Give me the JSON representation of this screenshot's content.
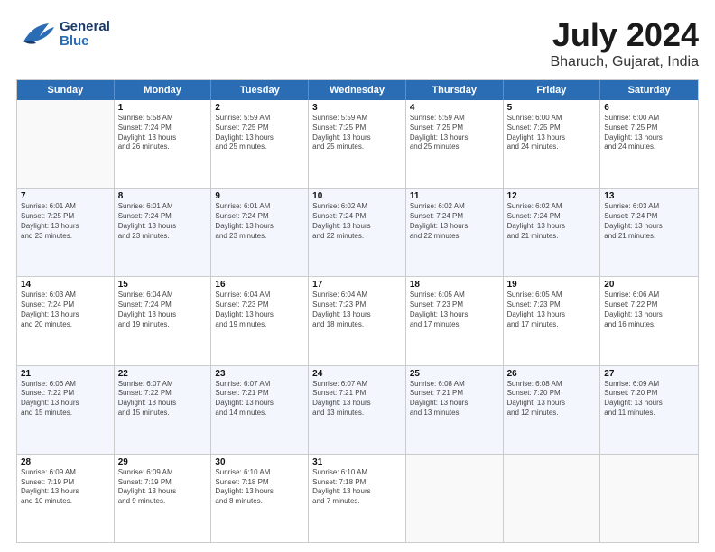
{
  "header": {
    "logo": {
      "general": "General",
      "blue": "Blue"
    },
    "title": "July 2024",
    "subtitle": "Bharuch, Gujarat, India"
  },
  "weekdays": [
    "Sunday",
    "Monday",
    "Tuesday",
    "Wednesday",
    "Thursday",
    "Friday",
    "Saturday"
  ],
  "weeks": [
    [
      {
        "day": "",
        "info": ""
      },
      {
        "day": "1",
        "info": "Sunrise: 5:58 AM\nSunset: 7:24 PM\nDaylight: 13 hours\nand 26 minutes."
      },
      {
        "day": "2",
        "info": "Sunrise: 5:59 AM\nSunset: 7:25 PM\nDaylight: 13 hours\nand 25 minutes."
      },
      {
        "day": "3",
        "info": "Sunrise: 5:59 AM\nSunset: 7:25 PM\nDaylight: 13 hours\nand 25 minutes."
      },
      {
        "day": "4",
        "info": "Sunrise: 5:59 AM\nSunset: 7:25 PM\nDaylight: 13 hours\nand 25 minutes."
      },
      {
        "day": "5",
        "info": "Sunrise: 6:00 AM\nSunset: 7:25 PM\nDaylight: 13 hours\nand 24 minutes."
      },
      {
        "day": "6",
        "info": "Sunrise: 6:00 AM\nSunset: 7:25 PM\nDaylight: 13 hours\nand 24 minutes."
      }
    ],
    [
      {
        "day": "7",
        "info": "Sunrise: 6:01 AM\nSunset: 7:25 PM\nDaylight: 13 hours\nand 23 minutes."
      },
      {
        "day": "8",
        "info": "Sunrise: 6:01 AM\nSunset: 7:24 PM\nDaylight: 13 hours\nand 23 minutes."
      },
      {
        "day": "9",
        "info": "Sunrise: 6:01 AM\nSunset: 7:24 PM\nDaylight: 13 hours\nand 23 minutes."
      },
      {
        "day": "10",
        "info": "Sunrise: 6:02 AM\nSunset: 7:24 PM\nDaylight: 13 hours\nand 22 minutes."
      },
      {
        "day": "11",
        "info": "Sunrise: 6:02 AM\nSunset: 7:24 PM\nDaylight: 13 hours\nand 22 minutes."
      },
      {
        "day": "12",
        "info": "Sunrise: 6:02 AM\nSunset: 7:24 PM\nDaylight: 13 hours\nand 21 minutes."
      },
      {
        "day": "13",
        "info": "Sunrise: 6:03 AM\nSunset: 7:24 PM\nDaylight: 13 hours\nand 21 minutes."
      }
    ],
    [
      {
        "day": "14",
        "info": "Sunrise: 6:03 AM\nSunset: 7:24 PM\nDaylight: 13 hours\nand 20 minutes."
      },
      {
        "day": "15",
        "info": "Sunrise: 6:04 AM\nSunset: 7:24 PM\nDaylight: 13 hours\nand 19 minutes."
      },
      {
        "day": "16",
        "info": "Sunrise: 6:04 AM\nSunset: 7:23 PM\nDaylight: 13 hours\nand 19 minutes."
      },
      {
        "day": "17",
        "info": "Sunrise: 6:04 AM\nSunset: 7:23 PM\nDaylight: 13 hours\nand 18 minutes."
      },
      {
        "day": "18",
        "info": "Sunrise: 6:05 AM\nSunset: 7:23 PM\nDaylight: 13 hours\nand 17 minutes."
      },
      {
        "day": "19",
        "info": "Sunrise: 6:05 AM\nSunset: 7:23 PM\nDaylight: 13 hours\nand 17 minutes."
      },
      {
        "day": "20",
        "info": "Sunrise: 6:06 AM\nSunset: 7:22 PM\nDaylight: 13 hours\nand 16 minutes."
      }
    ],
    [
      {
        "day": "21",
        "info": "Sunrise: 6:06 AM\nSunset: 7:22 PM\nDaylight: 13 hours\nand 15 minutes."
      },
      {
        "day": "22",
        "info": "Sunrise: 6:07 AM\nSunset: 7:22 PM\nDaylight: 13 hours\nand 15 minutes."
      },
      {
        "day": "23",
        "info": "Sunrise: 6:07 AM\nSunset: 7:21 PM\nDaylight: 13 hours\nand 14 minutes."
      },
      {
        "day": "24",
        "info": "Sunrise: 6:07 AM\nSunset: 7:21 PM\nDaylight: 13 hours\nand 13 minutes."
      },
      {
        "day": "25",
        "info": "Sunrise: 6:08 AM\nSunset: 7:21 PM\nDaylight: 13 hours\nand 13 minutes."
      },
      {
        "day": "26",
        "info": "Sunrise: 6:08 AM\nSunset: 7:20 PM\nDaylight: 13 hours\nand 12 minutes."
      },
      {
        "day": "27",
        "info": "Sunrise: 6:09 AM\nSunset: 7:20 PM\nDaylight: 13 hours\nand 11 minutes."
      }
    ],
    [
      {
        "day": "28",
        "info": "Sunrise: 6:09 AM\nSunset: 7:19 PM\nDaylight: 13 hours\nand 10 minutes."
      },
      {
        "day": "29",
        "info": "Sunrise: 6:09 AM\nSunset: 7:19 PM\nDaylight: 13 hours\nand 9 minutes."
      },
      {
        "day": "30",
        "info": "Sunrise: 6:10 AM\nSunset: 7:18 PM\nDaylight: 13 hours\nand 8 minutes."
      },
      {
        "day": "31",
        "info": "Sunrise: 6:10 AM\nSunset: 7:18 PM\nDaylight: 13 hours\nand 7 minutes."
      },
      {
        "day": "",
        "info": ""
      },
      {
        "day": "",
        "info": ""
      },
      {
        "day": "",
        "info": ""
      }
    ]
  ]
}
